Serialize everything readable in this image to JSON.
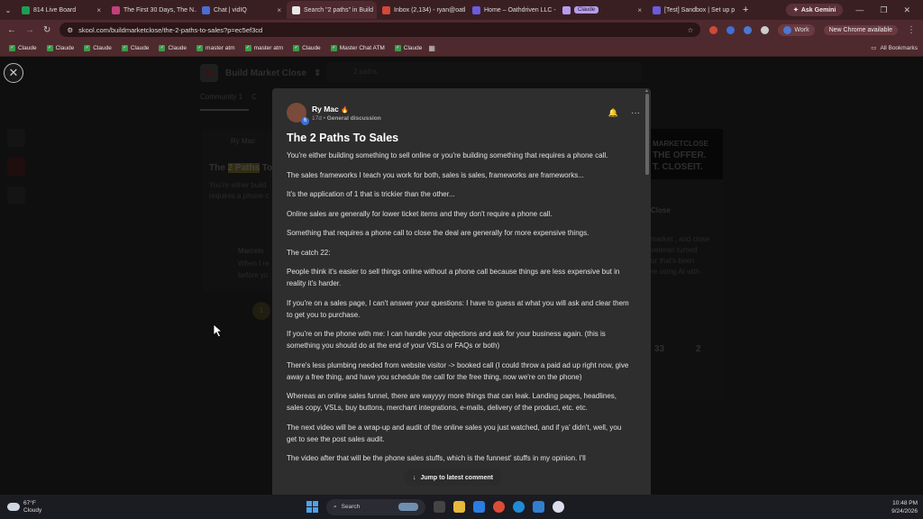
{
  "browser": {
    "tabs": [
      {
        "title": "814 Live Board",
        "color": "#1f9d55"
      },
      {
        "title": "The First 30 Days, The N...",
        "color": "#c2407a"
      },
      {
        "title": "Chat | vidIQ",
        "color": "#4a6cd4"
      },
      {
        "title": "Search \"2 paths\" in Build",
        "color": "#e8e8e8",
        "active": true
      },
      {
        "title": "Inbox (2,134) - ryan@oatl",
        "color": "#d44638"
      },
      {
        "title": "Home – Oathdriven LLC -",
        "color": "#6b5be0"
      },
      {
        "title": "Claude",
        "color": "#b59cf0",
        "pill": true
      },
      {
        "title": "[Test] Sandbox | Set up p",
        "color": "#6b5be0"
      }
    ],
    "new_tab": "+",
    "ask_gemini": "Ask Gemini",
    "url": "skool.com/buildmarketclose/the-2-paths-to-sales?p=ec5ef3cd",
    "profile": "Work",
    "update_label": "New Chrome available",
    "bookmarks": [
      "Claude",
      "Claude",
      "Claude",
      "Claude",
      "Claude",
      "master atm",
      "master atm",
      "Claude",
      "Master Chat ATM",
      "Claude"
    ],
    "all_bookmarks": "All Bookmarks"
  },
  "background": {
    "community": "Build Market Close",
    "search_placeholder": "2 paths",
    "tabs": [
      "Community 1",
      "C"
    ],
    "card_author": "Ry Mac",
    "card_title_prefix": "The",
    "card_title_highlight": "2 Paths",
    "card_title_suffix": "To",
    "card_excerpt_1": "You're either build",
    "card_excerpt_2": "requires a phone c",
    "commenter": "Marcelo",
    "comment_1": "When I re",
    "comment_2": "before yo",
    "page_num": "1",
    "banner_1": "MARKETCLOSE",
    "banner_2": "THE OFFER.",
    "banner_3": "T. CLOSEIT.",
    "right_title": "Close",
    "right_sub": "...",
    "right_line1": "market , and close",
    "right_line2": "veteran turned",
    "right_line3": "ur that's been",
    "right_line4": "re using AI with",
    "stat_1": "33",
    "stat_2": "2"
  },
  "post": {
    "author": "Ry Mac",
    "level": "6",
    "meta_time": "17d",
    "meta_category": "General discussion",
    "title": "The 2 Paths To Sales",
    "paragraphs": [
      "You're either building something to sell online or you're building something that requires a phone call.",
      "The sales frameworks I teach you work for both, sales is sales, frameworks are frameworks...",
      "It's the application of 1 that is trickier than the other...",
      "Online sales are generally for lower ticket items and they don't require a phone call.",
      "Something that requires a phone call to close the deal are generally for more expensive things.",
      "The catch 22:",
      "People think it's easier to sell things online without a phone call because things are less expensive but in reality it's harder.",
      "If you're on a sales page, I can't answer your questions: I have to guess at what you will ask and clear them to get you to purchase.",
      "If you're on the phone with me: I can handle your objections and ask for your business again. (this is something you should do at the end of your VSLs or FAQs or both)",
      "There's less plumbing needed from website visitor -> booked call (I could throw a paid ad up right now, give away a free thing, and have you schedule the call for the free thing, now we're on the phone)",
      "Whereas an online sales funnel, there are wayyyy more things that can leak. Landing pages, headlines, sales copy, VSLs, buy buttons, merchant integrations, e-mails, delivery of the product, etc. etc.",
      "The next video will be a wrap-up and audit of the online sales you just watched, and if ya' didn't, well, you get to see the post sales audit.",
      "The video after that will be the phone sales stuffs, which is the funnest' stuffs in my opinion. I'll"
    ],
    "jump_label": "Jump to latest comment"
  },
  "taskbar": {
    "temp": "67°F",
    "condition": "Cloudy",
    "search_label": "Search",
    "time": "10:48 PM",
    "date": "9/24/2026"
  }
}
